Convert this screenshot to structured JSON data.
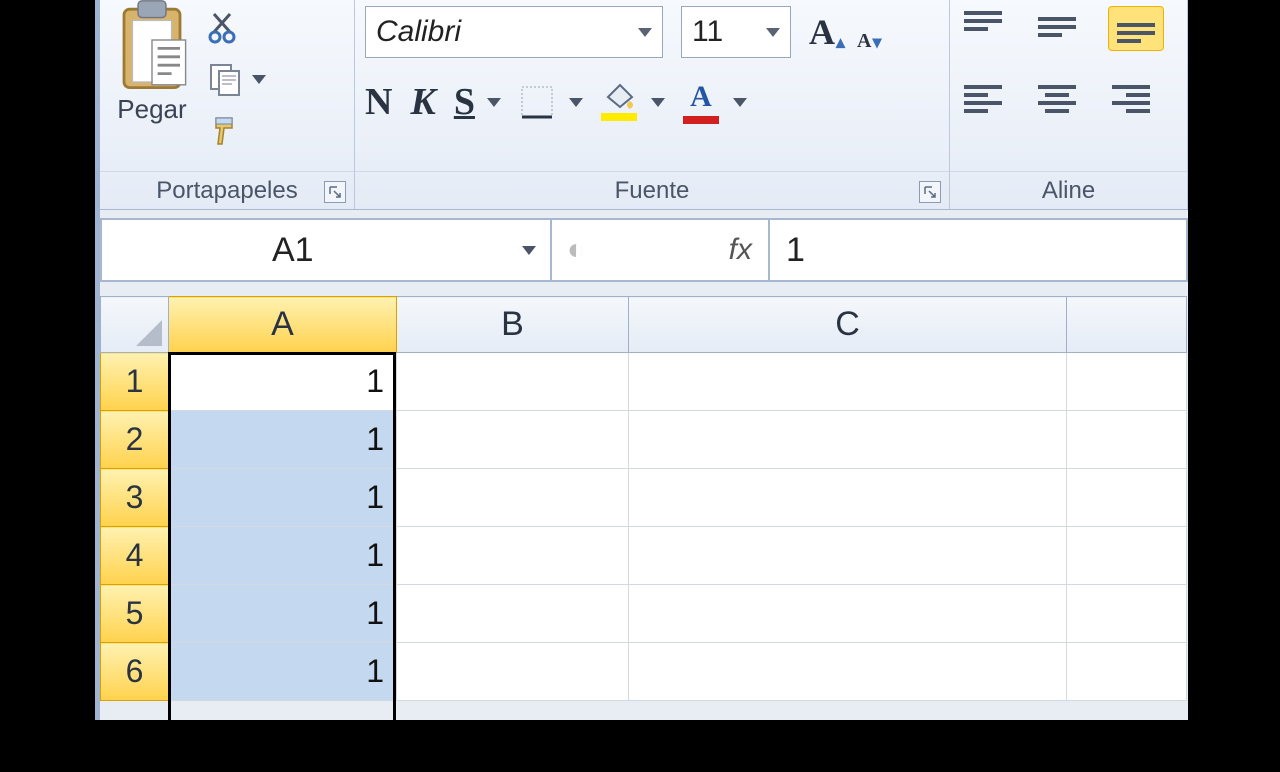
{
  "ribbon": {
    "clipboard": {
      "paste": "Pegar",
      "label": "Portapapeles"
    },
    "font": {
      "name": "Calibri",
      "size": "11",
      "bold": "N",
      "italic": "K",
      "underline": "S",
      "label": "Fuente"
    },
    "alignment": {
      "label": "Aline"
    }
  },
  "formula_bar": {
    "name_box": "A1",
    "fx_symbol": "fx",
    "value": "1"
  },
  "grid": {
    "columns": [
      "A",
      "B",
      "C"
    ],
    "selected_column": "A",
    "rows": [
      "1",
      "2",
      "3",
      "4",
      "5",
      "6"
    ],
    "cells_colA": [
      "1",
      "1",
      "1",
      "1",
      "1",
      "1"
    ],
    "active_cell": "A1",
    "selection_range": "A1:A6"
  }
}
